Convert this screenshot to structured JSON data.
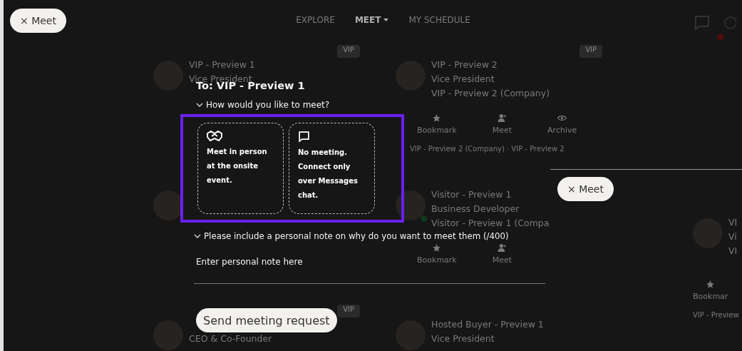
{
  "top_button": {
    "label": "× Meet"
  },
  "nav": [
    {
      "label": "EXPLORE",
      "selected": false,
      "menu": false
    },
    {
      "label": "MEET",
      "selected": true,
      "menu": true
    },
    {
      "label": "MY SCHEDULE",
      "selected": false,
      "menu": false
    }
  ],
  "cards": [
    {
      "badge": "VIP",
      "name": "VIP - Preview 1",
      "title": "Vice President",
      "online": false
    },
    {
      "badge": "VIP",
      "name": "VIP - Preview 2",
      "title": "Vice President",
      "company": "VIP - Preview 2 (Company)",
      "online": false,
      "actions": [
        {
          "kind": "bookmark",
          "label": "Bookmark"
        },
        {
          "kind": "meet",
          "label": "Meet"
        },
        {
          "kind": "archive",
          "label": "Archive"
        }
      ],
      "footer": "VIP - Preview 2 (Company) · VIP - Preview 2"
    },
    {
      "online": false
    },
    {
      "name": "Visitor - Preview 1",
      "title": "Business Developer",
      "company": "Visitor - Preview 1 (Compa",
      "online": true,
      "actions": [
        {
          "kind": "bookmark",
          "label": "Bookmark"
        },
        {
          "kind": "meet",
          "label": "Meet"
        }
      ]
    },
    {
      "badge": "VIP",
      "title": "CEO & Co-Founder",
      "online": false
    },
    {
      "name": "Hosted Buyer - Preview 1",
      "title": "Vice President",
      "online": false
    }
  ],
  "dialog": {
    "to": "To: VIP - Preview 1",
    "question": "How would you like to meet?",
    "options": [
      {
        "kind": "handshake",
        "label": "Meet in person at the onsite event."
      },
      {
        "kind": "chat",
        "label": "No meeting. Connect only over Messages chat."
      }
    ],
    "note_prompt": "Please include a personal note on why do you want to meet them (/400)",
    "note_placeholder": "Enter personal note here",
    "send_button": "Send meeting request"
  },
  "side_panel": {
    "button": "× Meet",
    "card": {
      "name": "VI",
      "title": "Vi",
      "company": "VI",
      "actions": [
        {
          "kind": "bookmark",
          "label": "Bookmar"
        }
      ],
      "footer": "VIP - Preview"
    }
  }
}
